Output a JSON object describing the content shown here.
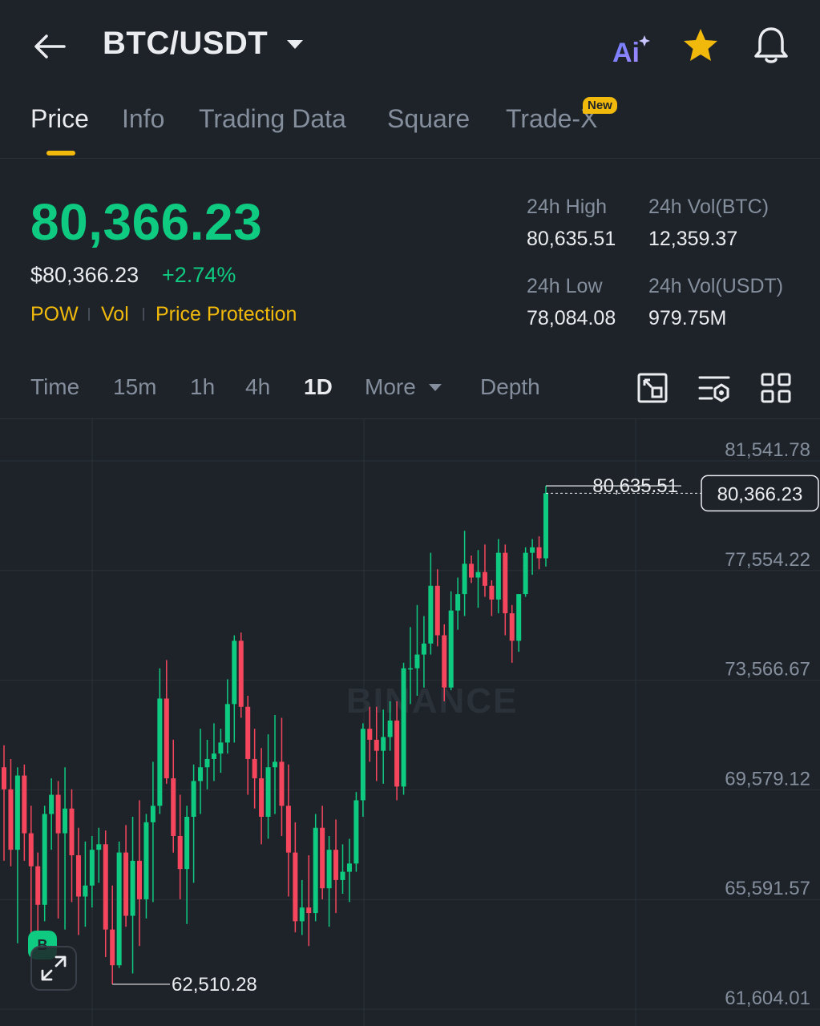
{
  "header": {
    "pair": "BTC/USDT",
    "ai_label": "Ai"
  },
  "tabs": [
    {
      "label": "Price",
      "active": true
    },
    {
      "label": "Info"
    },
    {
      "label": "Trading Data"
    },
    {
      "label": "Square"
    },
    {
      "label": "Trade-X",
      "badge": "New"
    }
  ],
  "ticker": {
    "last_price": "80,366.23",
    "usd_price": "$80,366.23",
    "change_pct": "+2.74%",
    "tags": [
      "POW",
      "Vol",
      "Price Protection"
    ],
    "high_label": "24h High",
    "high_value": "80,635.51",
    "vol_btc_label": "24h Vol(BTC)",
    "vol_btc_value": "12,359.37",
    "low_label": "24h Low",
    "low_value": "78,084.08",
    "vol_usdt_label": "24h Vol(USDT)",
    "vol_usdt_value": "979.75M"
  },
  "intervals": [
    {
      "label": "Time"
    },
    {
      "label": "15m"
    },
    {
      "label": "1h"
    },
    {
      "label": "4h"
    },
    {
      "label": "1D",
      "active": true
    },
    {
      "label": "More"
    },
    {
      "label": "Depth"
    }
  ],
  "colors": {
    "up": "#0ecb81",
    "down": "#f6465d",
    "accent": "#f0b90b",
    "bg": "#1e2329",
    "grid": "#2b3139",
    "muted": "#848e9c"
  },
  "chart_data": {
    "type": "candlestick",
    "watermark": "BINANCE",
    "y_ticks": [
      "81,541.78",
      "77,554.22",
      "73,566.67",
      "69,579.12",
      "65,591.57",
      "61,604.01"
    ],
    "ylim": [
      61604.01,
      81541.78
    ],
    "last_price_label": "80,366.23",
    "high_marker": "80,635.51",
    "low_marker": "62,510.28",
    "marker_letter": "B",
    "candles": [
      [
        70400,
        71200,
        67000,
        69600
      ],
      [
        69600,
        70700,
        66800,
        67400
      ],
      [
        67400,
        70400,
        64000,
        70100
      ],
      [
        70100,
        70500,
        67000,
        68000
      ],
      [
        68000,
        69000,
        64100,
        66800
      ],
      [
        66800,
        67300,
        64300,
        65400
      ],
      [
        65400,
        69000,
        64800,
        68700
      ],
      [
        68700,
        70000,
        67400,
        69400
      ],
      [
        69400,
        69900,
        64900,
        68000
      ],
      [
        68000,
        70400,
        64500,
        68900
      ],
      [
        68900,
        69600,
        65500,
        67200
      ],
      [
        67200,
        68200,
        64300,
        65700
      ],
      [
        65700,
        67700,
        64600,
        66100
      ],
      [
        66100,
        67900,
        65300,
        67400
      ],
      [
        67400,
        68200,
        66200,
        67600
      ],
      [
        67600,
        68100,
        63500,
        64500
      ],
      [
        64500,
        66100,
        62510,
        63200
      ],
      [
        63200,
        67700,
        63100,
        67300
      ],
      [
        67300,
        68300,
        64600,
        65000
      ],
      [
        65000,
        68600,
        62900,
        67000
      ],
      [
        67000,
        69200,
        63900,
        65600
      ],
      [
        65600,
        68700,
        64900,
        68400
      ],
      [
        68400,
        70600,
        65500,
        69000
      ],
      [
        69000,
        74000,
        68700,
        72900
      ],
      [
        72900,
        74300,
        69800,
        70000
      ],
      [
        70000,
        71400,
        67300,
        67900
      ],
      [
        67900,
        69400,
        65600,
        66700
      ],
      [
        66700,
        69000,
        64700,
        68600
      ],
      [
        68600,
        70500,
        66200,
        69900
      ],
      [
        69900,
        71800,
        68700,
        70400
      ],
      [
        70400,
        71400,
        69600,
        70700
      ],
      [
        70700,
        72000,
        69900,
        70900
      ],
      [
        70900,
        71800,
        70200,
        71300
      ],
      [
        71300,
        73600,
        70900,
        72700
      ],
      [
        72700,
        75200,
        71300,
        75000
      ],
      [
        75000,
        75300,
        72200,
        72600
      ],
      [
        72600,
        73000,
        69400,
        70700
      ],
      [
        70700,
        71800,
        68900,
        70000
      ],
      [
        70000,
        71100,
        67600,
        68600
      ],
      [
        68600,
        71600,
        67800,
        70400
      ],
      [
        70400,
        72300,
        68700,
        70600
      ],
      [
        70600,
        72200,
        67900,
        69000
      ],
      [
        69000,
        70500,
        65700,
        67300
      ],
      [
        67300,
        68400,
        64400,
        64800
      ],
      [
        64800,
        66300,
        64300,
        65300
      ],
      [
        65300,
        67200,
        63900,
        65100
      ],
      [
        65100,
        68700,
        64800,
        68200
      ],
      [
        68200,
        69000,
        65600,
        66000
      ],
      [
        66000,
        67900,
        64600,
        67400
      ],
      [
        67400,
        68500,
        65100,
        66300
      ],
      [
        66300,
        67600,
        65800,
        66600
      ],
      [
        66600,
        67800,
        65500,
        66900
      ],
      [
        66900,
        69500,
        66600,
        69200
      ],
      [
        69200,
        72000,
        68600,
        71800
      ],
      [
        71800,
        72600,
        70600,
        71400
      ],
      [
        71400,
        72600,
        69900,
        71000
      ],
      [
        71000,
        72500,
        69800,
        71500
      ],
      [
        71500,
        72800,
        71000,
        72100
      ],
      [
        72100,
        72800,
        69200,
        69700
      ],
      [
        69700,
        74200,
        69400,
        74000
      ],
      [
        74000,
        75500,
        72700,
        74000
      ],
      [
        74000,
        76300,
        73000,
        74500
      ],
      [
        74500,
        75900,
        73300,
        74900
      ],
      [
        74900,
        78200,
        74500,
        77000
      ],
      [
        77000,
        77600,
        74800,
        75200
      ],
      [
        75200,
        75600,
        72800,
        73300
      ],
      [
        73300,
        76800,
        73200,
        76100
      ],
      [
        76100,
        77300,
        75400,
        76700
      ],
      [
        76700,
        79000,
        75900,
        77800
      ],
      [
        77800,
        78100,
        77100,
        77300
      ],
      [
        77300,
        78300,
        76200,
        77500
      ],
      [
        77500,
        78500,
        76600,
        77000
      ],
      [
        77000,
        77200,
        75900,
        76500
      ],
      [
        76500,
        78700,
        76000,
        78200
      ],
      [
        78200,
        78500,
        75200,
        76000
      ],
      [
        76000,
        76300,
        74200,
        75000
      ],
      [
        75000,
        76700,
        74600,
        76700
      ],
      [
        76700,
        78400,
        76600,
        78200
      ],
      [
        78200,
        78700,
        77400,
        78400
      ],
      [
        78400,
        78800,
        77600,
        78000
      ],
      [
        78000,
        80635.51,
        77700,
        80366.23
      ]
    ]
  }
}
